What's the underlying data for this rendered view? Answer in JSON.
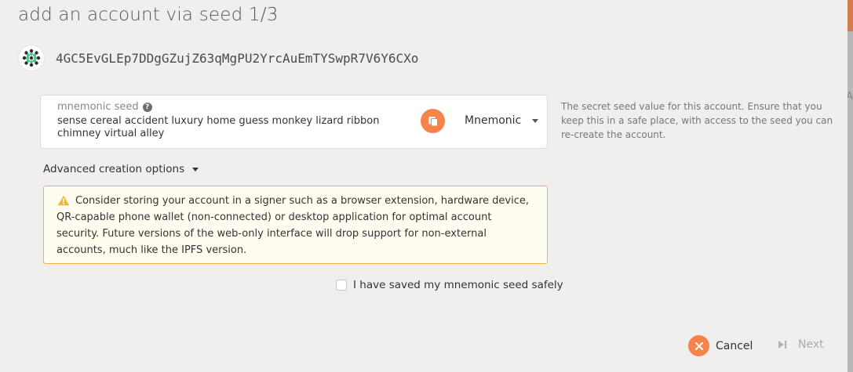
{
  "modal": {
    "title": "add an account via seed 1/3"
  },
  "account": {
    "address": "4GC5EvGLEp7DDgGZujZ63qMgPU2YrcAuEmTYSwpR7V6Y6CXo",
    "identicon_icon": "identicon-icon"
  },
  "seed": {
    "label": "mnemonic seed",
    "value": "sense cereal accident luxury home guess monkey lizard ribbon chimney virtual alley",
    "copy_icon": "copy-icon",
    "type_selected": "Mnemonic",
    "help_text": "The secret seed value for this account. Ensure that you keep this in a safe place, with access to the seed you can re-create the account."
  },
  "advanced": {
    "label": "Advanced creation options"
  },
  "warning": {
    "text": "Consider storing your account in a signer such as a browser extension, hardware device, QR-capable phone wallet (non-connected) or desktop application for optimal account security. Future versions of the web-only interface will drop support for non-external accounts, much like the IPFS version."
  },
  "confirm": {
    "label": "I have saved my mnemonic seed safely",
    "checked": false
  },
  "actions": {
    "cancel_label": "Cancel",
    "next_label": "Next"
  },
  "colors": {
    "accent": "#f5844a",
    "warning_border": "#f0b53f",
    "warning_bg": "#fffcf0",
    "modal_bg": "#f0efed"
  },
  "edge": {
    "right_char": "A"
  }
}
